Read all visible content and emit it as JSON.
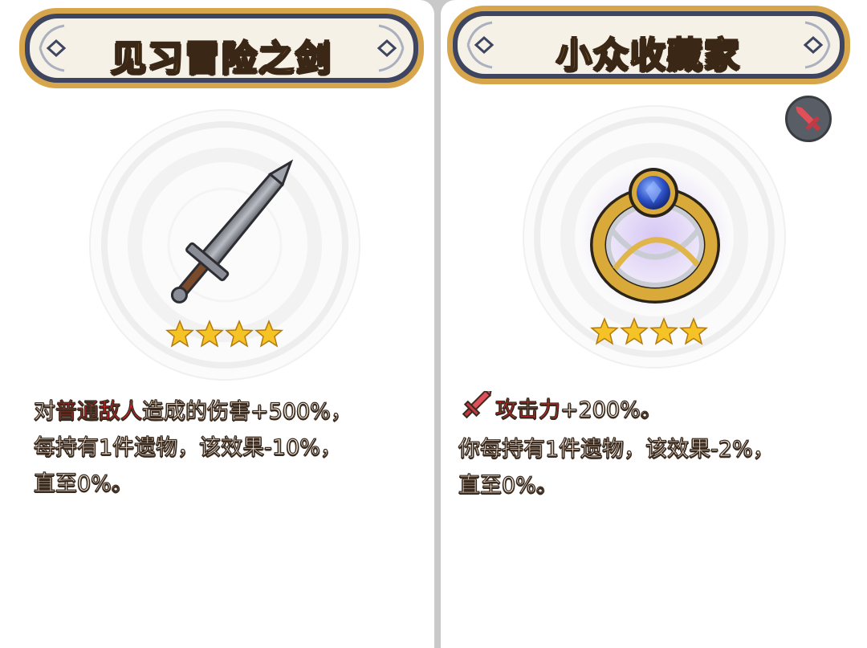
{
  "cards": [
    {
      "title": "见习冒险之剑",
      "item_icon": "sword-icon",
      "stars": 4,
      "description": {
        "line1_prefix": "对",
        "line1_highlight": "普通敌人",
        "line1_suffix": "造成的伤害+500%，",
        "line2": "每持有1件遗物，该效果-10%，",
        "line3": "直至0%。"
      }
    },
    {
      "title": "小众收藏家",
      "item_icon": "sapphire-ring-icon",
      "stars": 4,
      "badge_icon": "sword-icon",
      "description": {
        "stat_icon": "sword-icon",
        "line1_highlight": "攻击力",
        "line1_suffix": "+200%。",
        "line2": "你每持有1件遗物，该效果-2%，",
        "line3": "直至0%。"
      }
    }
  ],
  "colors": {
    "title_fill": "#f3bf3a",
    "title_outline": "#3b2716",
    "banner_border": "#d7a64c",
    "banner_inner": "#3d4560",
    "highlight": "#d3262c",
    "star": "#f6c326"
  }
}
